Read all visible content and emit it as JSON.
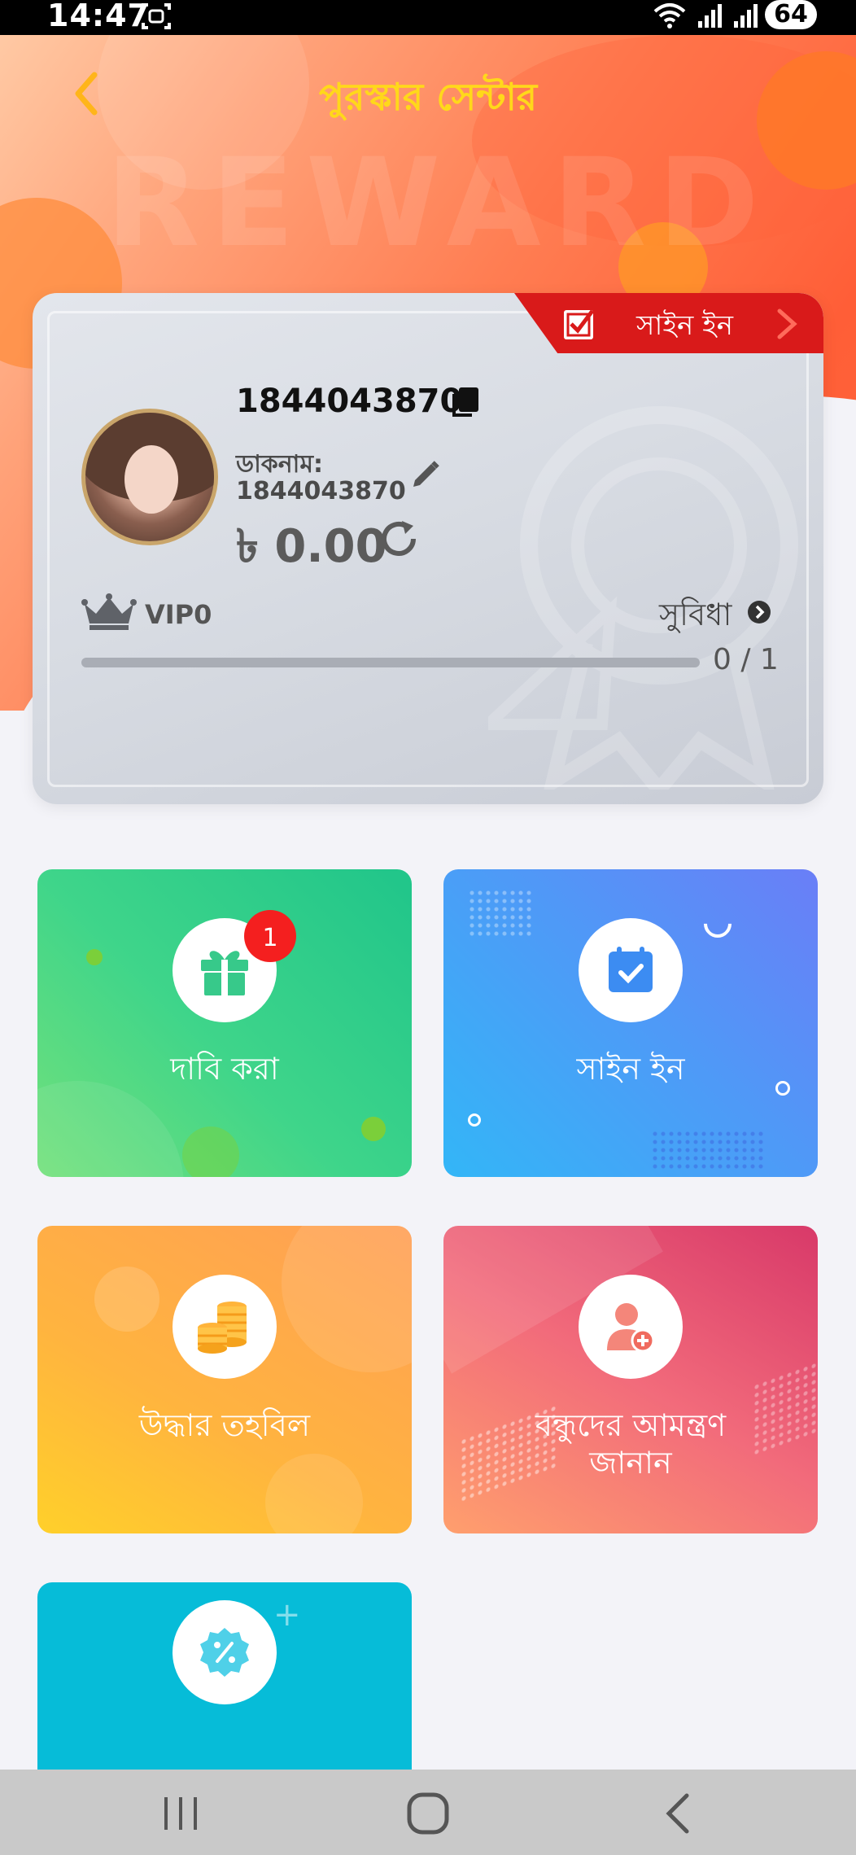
{
  "status_bar": {
    "time": "14:47",
    "battery": "64",
    "icons": [
      "screenshot-icon",
      "wifi-icon",
      "signal-icon",
      "signal-roaming-icon",
      "battery-icon"
    ]
  },
  "header": {
    "title": "পুরস্কার সেন্টার",
    "watermark": "REWARD",
    "back_icon": "chevron-left-icon"
  },
  "profile": {
    "signin_ribbon_label": "সাইন ইন",
    "user_id": "1844043870",
    "nickname_label": "ডাকনাম:",
    "nickname_value": "1844043870",
    "balance": "৳ 0.00",
    "vip_level": "VIP0",
    "benefits_label": "সুবিধা",
    "vip_progress_text": "0 / 1",
    "vip_progress_fraction": 0
  },
  "tiles": [
    {
      "label": "দাবি করা",
      "badge": "1",
      "icon": "gift-icon"
    },
    {
      "label": "সাইন ইন",
      "icon": "calendar-check-icon"
    },
    {
      "label": "উদ্ধার তহবিল",
      "icon": "coins-icon"
    },
    {
      "label": "বন্ধুদের আমন্ত্রণ জানান",
      "icon": "add-user-icon"
    },
    {
      "label": "",
      "icon": "discount-badge-icon"
    }
  ],
  "colors": {
    "header_accent": "#ffd81a",
    "ribbon": "#d91a1a",
    "badge": "#f41f1f"
  }
}
